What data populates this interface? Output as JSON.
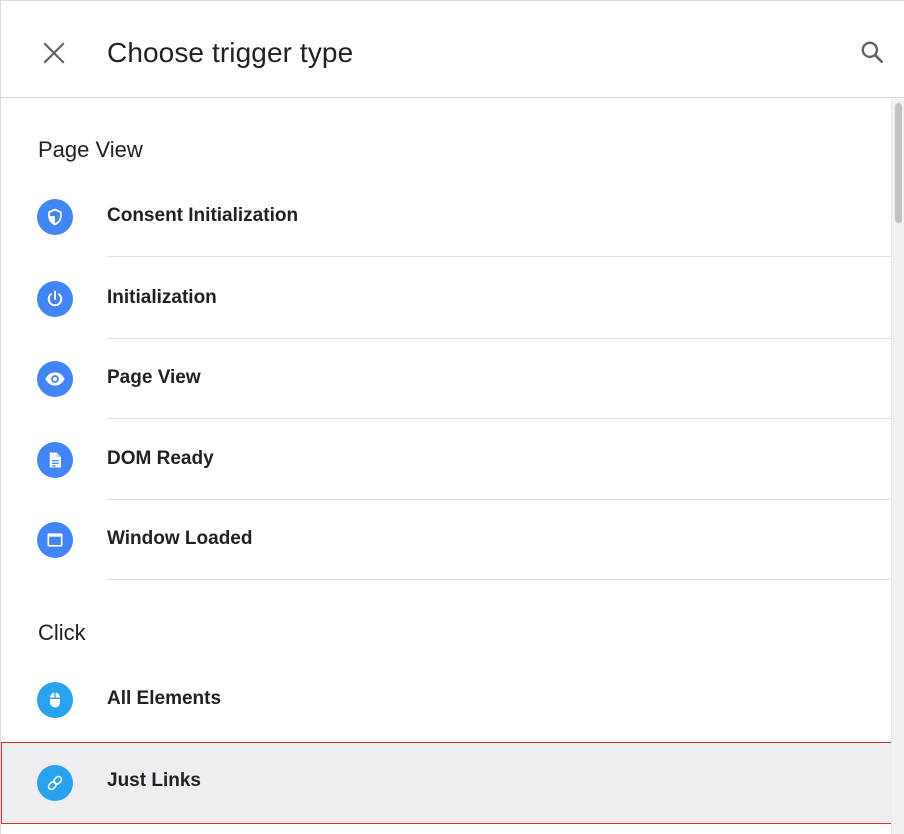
{
  "header": {
    "title": "Choose trigger type",
    "close_icon": "close-icon",
    "search_icon": "search-icon"
  },
  "colors": {
    "accent_blue": "#4285f4",
    "accent_light_blue": "#29a3f0",
    "highlight_border": "#d93025",
    "selected_background": "#eeedf2"
  },
  "sections": [
    {
      "title": "Page View",
      "items": [
        {
          "label": "Consent Initialization",
          "icon": "shield-icon"
        },
        {
          "label": "Initialization",
          "icon": "power-icon"
        },
        {
          "label": "Page View",
          "icon": "eye-icon"
        },
        {
          "label": "DOM Ready",
          "icon": "document-icon"
        },
        {
          "label": "Window Loaded",
          "icon": "window-icon"
        }
      ]
    },
    {
      "title": "Click",
      "items": [
        {
          "label": "All Elements",
          "icon": "mouse-icon"
        },
        {
          "label": "Just Links",
          "icon": "link-icon",
          "selected": true
        }
      ]
    }
  ]
}
